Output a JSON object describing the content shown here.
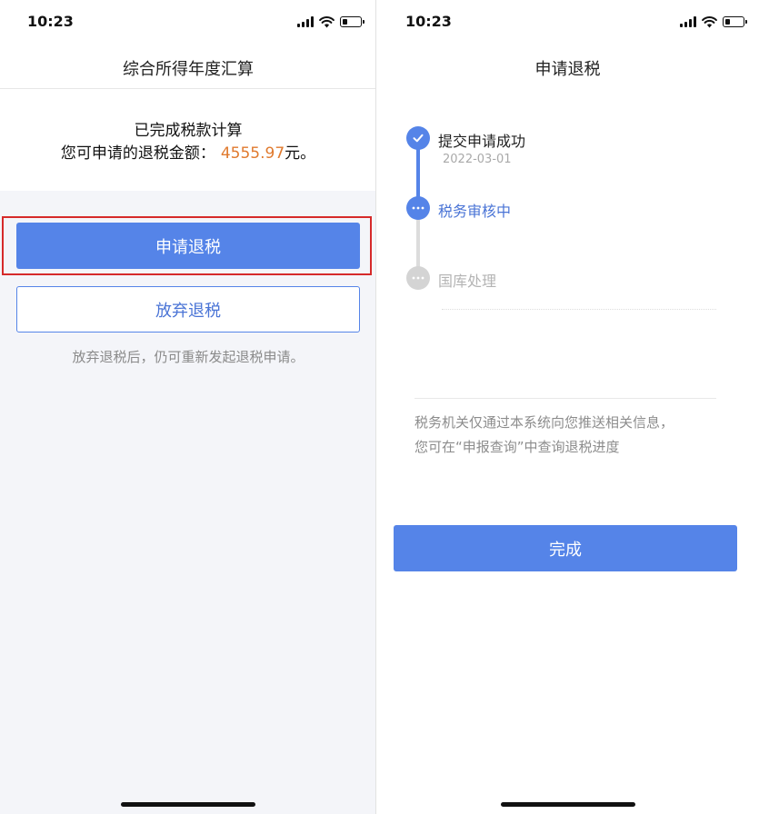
{
  "left": {
    "status": {
      "time": "10:23",
      "battery_level": 0.3
    },
    "nav": {
      "title": "综合所得年度汇算"
    },
    "result": {
      "title": "已完成税款计算",
      "amount_label": "您可申请的退税金额：",
      "amount": "4555.97",
      "amount_suffix": "元。"
    },
    "apply_button": "申请退税",
    "abandon_button": "放弃退税",
    "hint": "放弃退税后，仍可重新发起退税申请。"
  },
  "right": {
    "status": {
      "time": "10:23",
      "battery_level": 0.3
    },
    "nav": {
      "title": "申请退税"
    },
    "steps": [
      {
        "label": "提交申请成功",
        "date": "2022-03-01",
        "state": "done",
        "color": "#222222"
      },
      {
        "label": "税务审核中",
        "state": "active",
        "color": "#4a74d6"
      },
      {
        "label": "国库处理",
        "state": "pending",
        "color": "#b4b4b4"
      }
    ],
    "notice": [
      "税务机关仅通过本系统向您推送相关信息，",
      "您可在“申报查询”中查询退税进度"
    ],
    "done_button": "完成"
  },
  "colors": {
    "primary": "#5584e8",
    "amount": "#e07a2e",
    "highlight": "#d62a2a",
    "page_bg": "#f4f5f9"
  },
  "icons": {
    "step_done": "check-icon",
    "step_active": "ellipsis-icon",
    "step_pending": "ellipsis-icon"
  }
}
